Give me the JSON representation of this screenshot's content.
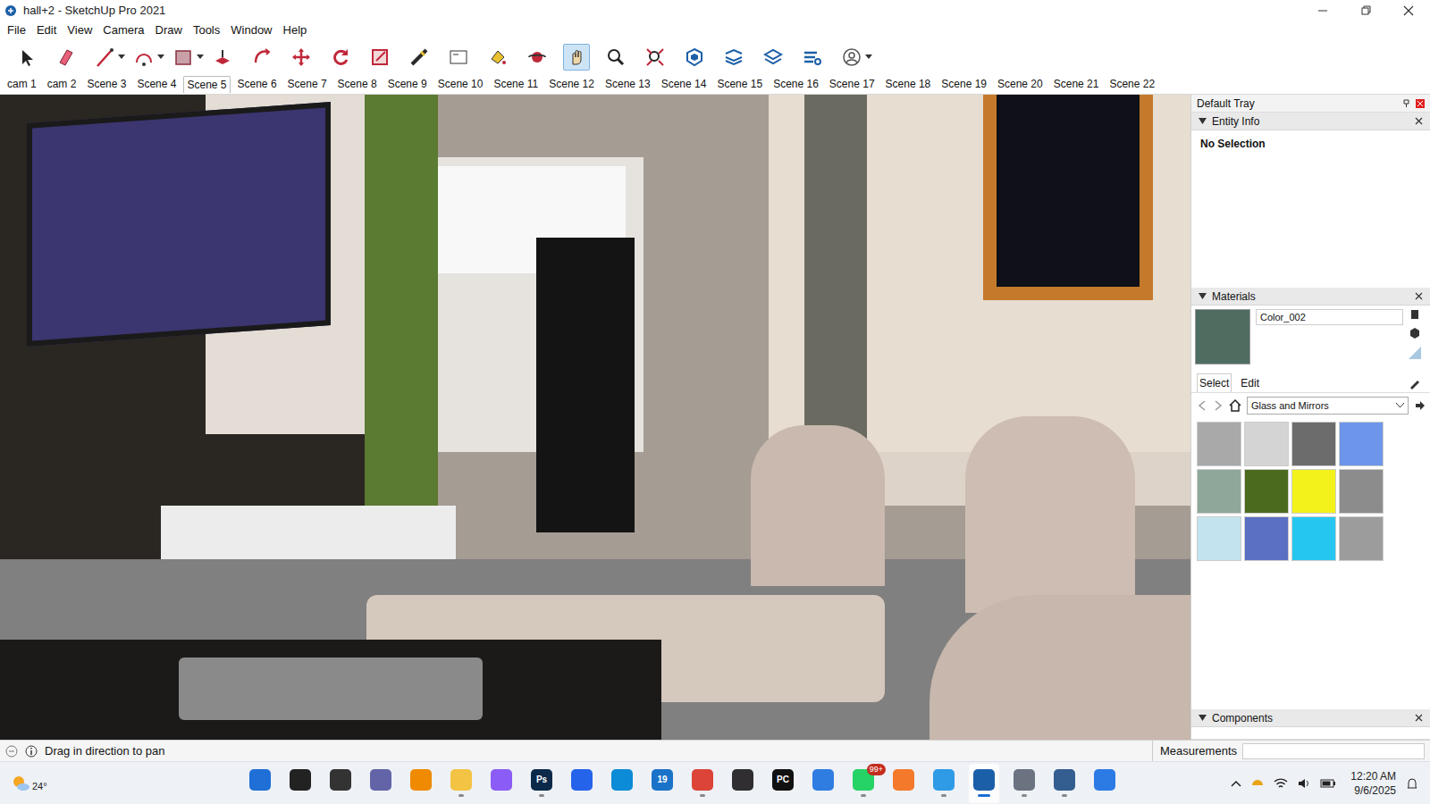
{
  "window": {
    "title": "hall+2 - SketchUp Pro 2021"
  },
  "menu": [
    "File",
    "Edit",
    "View",
    "Camera",
    "Draw",
    "Tools",
    "Window",
    "Help"
  ],
  "toolbar": [
    {
      "name": "select",
      "selected": false,
      "has_menu": false
    },
    {
      "name": "eraser",
      "selected": false,
      "has_menu": false
    },
    {
      "name": "line",
      "selected": false,
      "has_menu": true
    },
    {
      "name": "arc",
      "selected": false,
      "has_menu": true
    },
    {
      "name": "rectangle",
      "selected": false,
      "has_menu": true
    },
    {
      "name": "push-pull",
      "selected": false,
      "has_menu": false
    },
    {
      "name": "offset",
      "selected": false,
      "has_menu": false
    },
    {
      "name": "move",
      "selected": false,
      "has_menu": false
    },
    {
      "name": "rotate",
      "selected": false,
      "has_menu": false
    },
    {
      "name": "scale",
      "selected": false,
      "has_menu": false
    },
    {
      "name": "tape",
      "selected": false,
      "has_menu": false
    },
    {
      "name": "text",
      "selected": false,
      "has_menu": false
    },
    {
      "name": "paint",
      "selected": false,
      "has_menu": false
    },
    {
      "name": "orbit",
      "selected": false,
      "has_menu": false
    },
    {
      "name": "pan",
      "selected": true,
      "has_menu": false
    },
    {
      "name": "zoom",
      "selected": false,
      "has_menu": false
    },
    {
      "name": "zoom-extents",
      "selected": false,
      "has_menu": false
    },
    {
      "name": "warehouse",
      "selected": false,
      "has_menu": false
    },
    {
      "name": "extension",
      "selected": false,
      "has_menu": false
    },
    {
      "name": "share",
      "selected": false,
      "has_menu": false
    },
    {
      "name": "extension-manager",
      "selected": false,
      "has_menu": false
    },
    {
      "name": "profile",
      "selected": false,
      "has_menu": true
    }
  ],
  "scenes": [
    {
      "label": "cam 1",
      "selected": false
    },
    {
      "label": "cam 2",
      "selected": false
    },
    {
      "label": "Scene 3",
      "selected": false
    },
    {
      "label": "Scene 4",
      "selected": false
    },
    {
      "label": "Scene 5",
      "selected": true
    },
    {
      "label": "Scene 6",
      "selected": false
    },
    {
      "label": "Scene 7",
      "selected": false
    },
    {
      "label": "Scene 8",
      "selected": false
    },
    {
      "label": "Scene 9",
      "selected": false
    },
    {
      "label": "Scene 10",
      "selected": false
    },
    {
      "label": "Scene 11",
      "selected": false
    },
    {
      "label": "Scene 12",
      "selected": false
    },
    {
      "label": "Scene 13",
      "selected": false
    },
    {
      "label": "Scene 14",
      "selected": false
    },
    {
      "label": "Scene 15",
      "selected": false
    },
    {
      "label": "Scene 16",
      "selected": false
    },
    {
      "label": "Scene 17",
      "selected": false
    },
    {
      "label": "Scene 18",
      "selected": false
    },
    {
      "label": "Scene 19",
      "selected": false
    },
    {
      "label": "Scene 20",
      "selected": false
    },
    {
      "label": "Scene 21",
      "selected": false
    },
    {
      "label": "Scene 22",
      "selected": false
    }
  ],
  "tray": {
    "title": "Default Tray",
    "entity_info": {
      "title": "Entity Info",
      "expanded": true,
      "value": "No Selection"
    },
    "materials": {
      "title": "Materials",
      "expanded": true,
      "current": "Color_002",
      "current_color": "#4e6d60",
      "tabs": [
        {
          "label": "Select",
          "selected": true
        },
        {
          "label": "Edit",
          "selected": false
        }
      ],
      "library": "Glass and Mirrors",
      "swatches": [
        {
          "color": "#a9a9a9"
        },
        {
          "color": "#d4d4d4"
        },
        {
          "color": "#6c6c6c"
        },
        {
          "color": "#6d96ea"
        },
        {
          "color": "#8fa79a"
        },
        {
          "color": "#4c6a1e"
        },
        {
          "color": "#f3f21b"
        },
        {
          "color": "#8c8c8c"
        },
        {
          "color": "#c3e4ef"
        },
        {
          "color": "#5b70c2"
        },
        {
          "color": "#25c7f0"
        },
        {
          "color": "#9c9c9c"
        }
      ]
    },
    "components": {
      "title": "Components",
      "expanded": true
    }
  },
  "status_bar": {
    "hint": "Drag in direction to pan",
    "measurements_label": "Measurements"
  },
  "taskbar": {
    "weather": "24°",
    "apps": [
      {
        "name": "start",
        "running": false,
        "active": false
      },
      {
        "name": "search",
        "running": false,
        "active": false
      },
      {
        "name": "task-view",
        "running": false,
        "active": false
      },
      {
        "name": "chat",
        "running": false,
        "active": false
      },
      {
        "name": "vlc",
        "running": false,
        "active": false
      },
      {
        "name": "file-explorer",
        "running": true,
        "active": false
      },
      {
        "name": "copilot",
        "running": false,
        "active": false
      },
      {
        "name": "photoshop",
        "running": true,
        "active": false,
        "label": "Ps"
      },
      {
        "name": "store",
        "running": false,
        "active": false
      },
      {
        "name": "edge",
        "running": false,
        "active": false
      },
      {
        "name": "calendar",
        "running": false,
        "active": false,
        "label": "19"
      },
      {
        "name": "chrome",
        "running": true,
        "active": false
      },
      {
        "name": "obs",
        "running": false,
        "active": false
      },
      {
        "name": "pycharm",
        "running": false,
        "active": false,
        "label": "PC"
      },
      {
        "name": "todo",
        "running": false,
        "active": false
      },
      {
        "name": "whatsapp",
        "running": true,
        "active": false,
        "badge": "99+"
      },
      {
        "name": "blender",
        "running": false,
        "active": false
      },
      {
        "name": "photos",
        "running": true,
        "active": false
      },
      {
        "name": "sketchup",
        "running": true,
        "active": true
      },
      {
        "name": "settings",
        "running": true,
        "active": false
      },
      {
        "name": "layout",
        "running": true,
        "active": false
      },
      {
        "name": "snipping",
        "running": false,
        "active": false
      }
    ],
    "time": "12:20 AM",
    "date": "9/6/2025"
  }
}
